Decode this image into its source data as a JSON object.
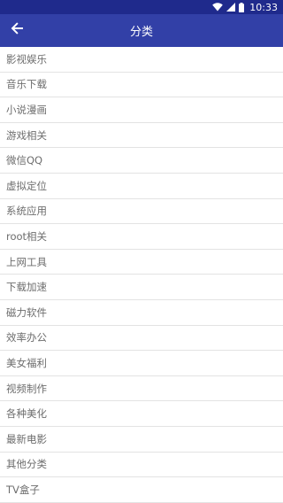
{
  "status_bar": {
    "time": "10:33",
    "icons": [
      "wifi-icon",
      "signal-icon",
      "battery-icon"
    ],
    "background": "#1f2a8c"
  },
  "app_bar": {
    "title": "分类",
    "back_icon": "arrow-left-icon",
    "background": "#3240a7"
  },
  "categories": [
    "影视娱乐",
    "音乐下载",
    "小说漫画",
    "游戏相关",
    "微信QQ",
    "虚拟定位",
    "系统应用",
    "root相关",
    "上网工具",
    "下载加速",
    "磁力软件",
    "效率办公",
    "美女福利",
    "视频制作",
    "各种美化",
    "最新电影",
    "其他分类",
    "TV盒子"
  ]
}
